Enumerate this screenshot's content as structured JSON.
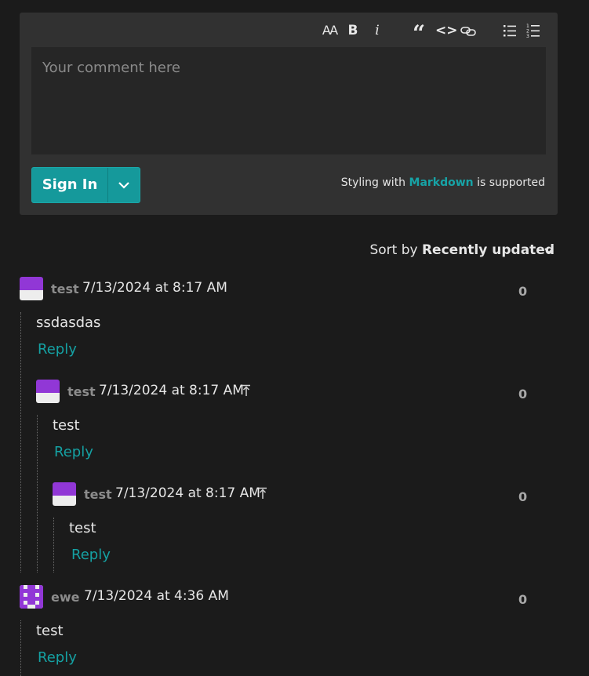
{
  "editor": {
    "toolbar": {
      "heading": "AA",
      "bold": "B",
      "italic": "i",
      "quote": "“",
      "code": "<>",
      "link_icon": "link-icon",
      "bullet_icon": "bulleted-list-icon",
      "number_icon": "numbered-list-icon"
    },
    "placeholder": "Your comment here",
    "signin_label": "Sign In",
    "md_prefix": "Styling with",
    "md_link": "Markdown",
    "md_suffix": "is supported"
  },
  "sort": {
    "label": "Sort by",
    "value": "Recently updated"
  },
  "comments": [
    {
      "author": "test",
      "time": "7/13/2024 at 8:17 AM",
      "votes": "0",
      "text": "ssdasdas",
      "reply": "Reply"
    },
    {
      "author": "test",
      "time": "7/13/2024 at 8:17 AM",
      "votes": "0",
      "text": "test",
      "reply": "Reply"
    },
    {
      "author": "test",
      "time": "7/13/2024 at 8:17 AM",
      "votes": "0",
      "text": "test",
      "reply": "Reply"
    },
    {
      "author": "ewe",
      "time": "7/13/2024 at 4:36 AM",
      "votes": "0",
      "text": "test",
      "reply": "Reply"
    }
  ],
  "colors": {
    "accent": "#15999b",
    "avatar_purple": "#9137d6",
    "background": "#1b1b1b",
    "panel": "#313131"
  }
}
